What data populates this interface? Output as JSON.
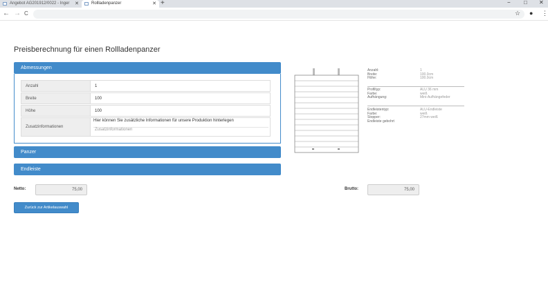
{
  "browser": {
    "tabs": [
      {
        "label": "Angebot AG201912/0022 - Inger"
      },
      {
        "label": "Rollladenpanzer"
      }
    ],
    "icons": {
      "back": "←",
      "forward": "→",
      "reload": "C",
      "star": "☆",
      "account": "●",
      "menu": "⋮",
      "new_tab": "+",
      "close": "✕",
      "minimize": "−",
      "maximize": "□"
    }
  },
  "page": {
    "title": "Preisberechnung für einen Rollladenpanzer",
    "sections": {
      "abmessungen": "Abmessungen",
      "panzer": "Panzer",
      "endleiste": "Endleiste"
    },
    "fields": [
      {
        "label": "Anzahl",
        "value": "1"
      },
      {
        "label": "Breite",
        "value": "100"
      },
      {
        "label": "Höhe",
        "value": "100"
      }
    ],
    "zusatz": {
      "label": "Zusatzinformationen",
      "hint": "Hier können Sie zusätzliche Informationen für unsere Produktion hinterlegen",
      "placeholder": "Zusatzinformationen"
    },
    "netto": {
      "label": "Netto:",
      "value": "75,00"
    },
    "brutto": {
      "label": "Brutto:",
      "value": "75,00"
    },
    "back_button": "Zurück zur Artikelauswahl"
  },
  "spec": {
    "group1": [
      {
        "key": "Anzahl:",
        "value": "1"
      },
      {
        "key": "Breite:",
        "value": "100.0cm"
      },
      {
        "key": "Höhe:",
        "value": "100.0cm"
      }
    ],
    "group2": [
      {
        "key": "Profiltyp:",
        "value": "ALU 36 mm"
      },
      {
        "key": "Farbe:",
        "value": "weiß"
      },
      {
        "key": "Aufhängung:",
        "value": "Mini-Aufhängefeder"
      }
    ],
    "group3": [
      {
        "key": "Endleistentyp:",
        "value": "ALU-Endleiste"
      },
      {
        "key": "Farbe:",
        "value": "weiß"
      },
      {
        "key": "Stopper:",
        "value": "27mm weiß"
      },
      {
        "key": "Endleiste gebohrt",
        "value": ""
      }
    ]
  }
}
